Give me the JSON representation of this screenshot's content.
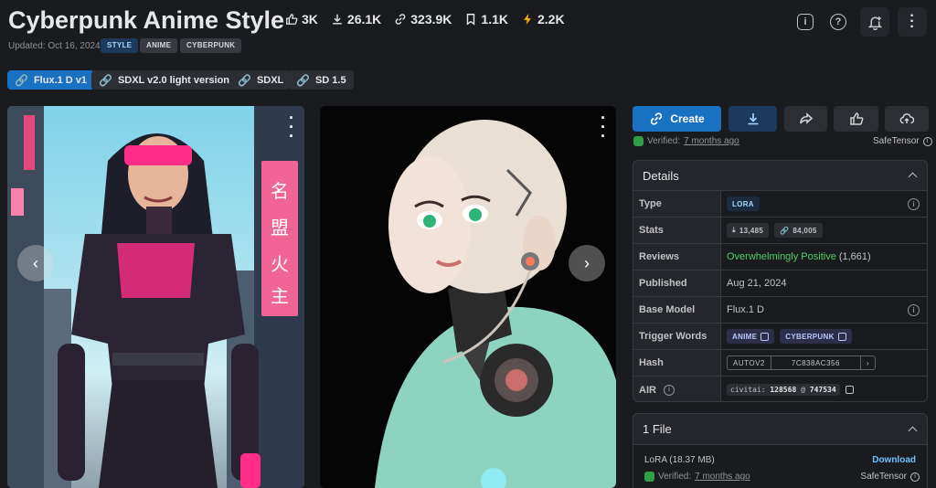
{
  "header": {
    "title": "Cyberpunk Anime Style",
    "stats": [
      {
        "icon": "thumbs-up-icon",
        "value": "3K"
      },
      {
        "icon": "download-icon",
        "value": "26.1K"
      },
      {
        "icon": "link-icon",
        "value": "323.9K"
      },
      {
        "icon": "bookmark-icon",
        "value": "1.1K"
      },
      {
        "icon": "bolt-icon",
        "value": "2.2K"
      }
    ],
    "updated": "Updated: Oct 16, 2024",
    "tags": [
      "STYLE",
      "ANIME",
      "CYBERPUNK"
    ],
    "icons": [
      "info-icon",
      "help-icon",
      "bell-plus-icon",
      "more-icon"
    ]
  },
  "versions": [
    "Flux.1 D v1",
    "SDXL v2.0 light version",
    "SDXL",
    "SD 1.5"
  ],
  "actions": {
    "create": "Create",
    "verified_prefix": "Verified:",
    "verified_when": "7 months ago",
    "safetensor": "SafeTensor"
  },
  "details": {
    "title": "Details",
    "rows": {
      "type_label": "Type",
      "type_value": "LORA",
      "stats_label": "Stats",
      "stats_downloads": "13,485",
      "stats_generations": "84,005",
      "reviews_label": "Reviews",
      "reviews_value": "Overwhelmingly Positive",
      "reviews_count": "(1,661)",
      "published_label": "Published",
      "published_value": "Aug 21, 2024",
      "base_label": "Base Model",
      "base_value": "Flux.1 D",
      "trigger_label": "Trigger Words",
      "trigger_1": "ANIME",
      "trigger_2": "CYBERPUNK",
      "hash_label": "Hash",
      "hash_type": "AUTOV2",
      "hash_value": "7C838AC356",
      "air_label": "AIR",
      "air_prefix": "civitai:",
      "air_model": "128568",
      "air_at": "@",
      "air_version": "747534"
    }
  },
  "files": {
    "title": "1 File",
    "name": "LoRA (18.37 MB)",
    "download": "Download",
    "verified_prefix": "Verified:",
    "verified_when": "7 months ago",
    "safetensor": "SafeTensor"
  }
}
